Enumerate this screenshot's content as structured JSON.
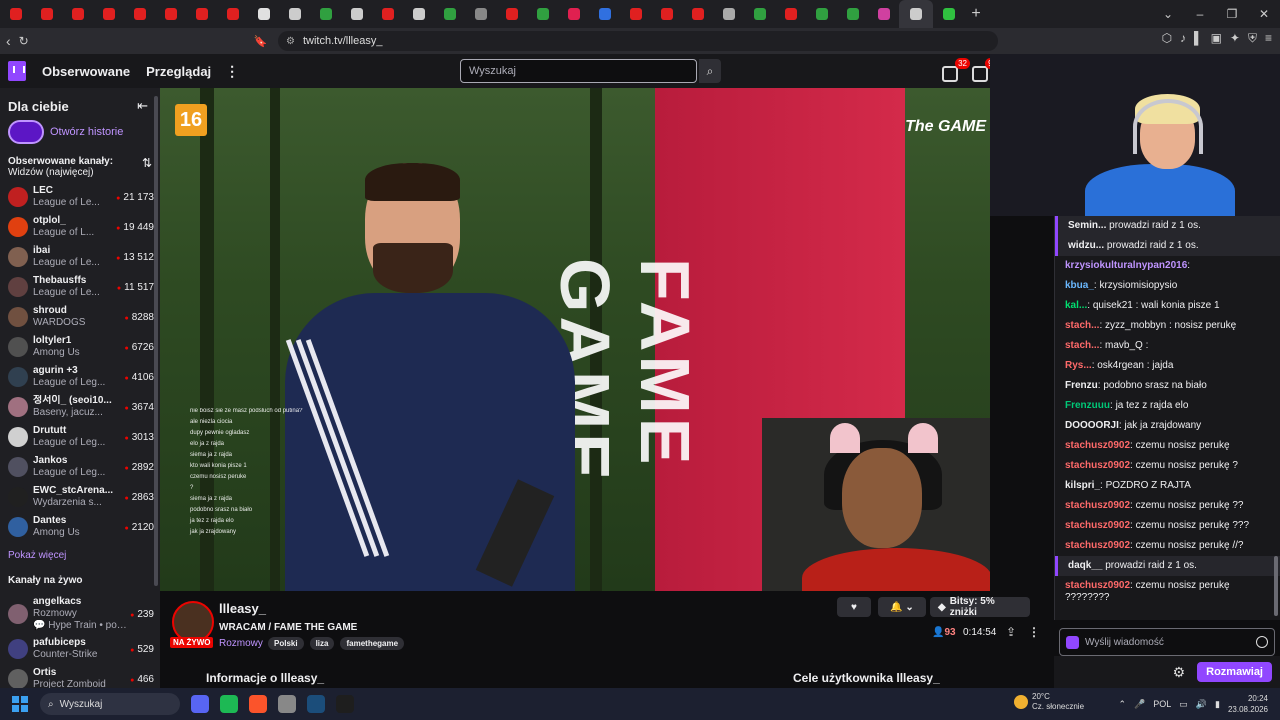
{
  "browser": {
    "url": "twitch.tv/llleasy_",
    "tabs": [
      {
        "color": "#e02020"
      },
      {
        "color": "#e02020"
      },
      {
        "color": "#e02020"
      },
      {
        "color": "#e02020"
      },
      {
        "color": "#e02020"
      },
      {
        "color": "#e02020"
      },
      {
        "color": "#e02020"
      },
      {
        "color": "#e02020"
      },
      {
        "color": "#e0e0e0"
      },
      {
        "color": "#cccccc"
      },
      {
        "color": "#30a040"
      },
      {
        "color": "#cccccc"
      },
      {
        "color": "#e02020"
      },
      {
        "color": "#cccccc"
      },
      {
        "color": "#30a040"
      },
      {
        "color": "#888888"
      },
      {
        "color": "#e02020"
      },
      {
        "color": "#30a040"
      },
      {
        "color": "#e02050"
      },
      {
        "color": "#3070e0"
      },
      {
        "color": "#e02020"
      },
      {
        "color": "#e02020"
      },
      {
        "color": "#e02020"
      },
      {
        "color": "#aaaaaa"
      },
      {
        "color": "#30a040"
      },
      {
        "color": "#e02020"
      },
      {
        "color": "#30a040"
      },
      {
        "color": "#30a040"
      },
      {
        "color": "#d040a0"
      },
      {
        "color": "#cccccc"
      },
      {
        "color": "#30c040"
      }
    ]
  },
  "nav": {
    "following": "Obserwowane",
    "browse": "Przeglądaj",
    "search_placeholder": "Wyszukaj",
    "badge1": "32",
    "badge2": "99"
  },
  "sidebar": {
    "title": "Dla ciebie",
    "stories": "Otwórz historie",
    "followed_title": "Obserwowane kanały:",
    "followed_sort": "Widzów (najwięcej)",
    "channels": [
      {
        "name": "LEC",
        "game": "League of Le...",
        "viewers": "21 173",
        "color": "#c02020"
      },
      {
        "name": "otplol_",
        "game": "League of L...",
        "viewers": "19 449",
        "color": "#e04010"
      },
      {
        "name": "ibai",
        "game": "League of Le...",
        "viewers": "13 512",
        "color": "#806050"
      },
      {
        "name": "Thebausffs",
        "game": "League of Le...",
        "viewers": "11 517",
        "color": "#604040"
      },
      {
        "name": "shroud",
        "game": "WARDOGS",
        "viewers": "8288",
        "color": "#705040"
      },
      {
        "name": "loltyler1",
        "game": "Among Us",
        "viewers": "6726",
        "color": "#505050"
      },
      {
        "name": "agurin +3",
        "game": "League of Leg...",
        "viewers": "4106",
        "color": "#304050"
      },
      {
        "name": "정서이_ (seoi10...",
        "game": "Baseny, jacuz...",
        "viewers": "3674",
        "color": "#a07080"
      },
      {
        "name": "Drututt",
        "game": "League of Leg...",
        "viewers": "3013",
        "color": "#d0d0d0"
      },
      {
        "name": "Jankos",
        "game": "League of Leg...",
        "viewers": "2892",
        "color": "#505060"
      },
      {
        "name": "EWC_stcArena...",
        "game": "Wydarzenia s...",
        "viewers": "2863",
        "color": "#202020"
      },
      {
        "name": "Dantes",
        "game": "Among Us",
        "viewers": "2120",
        "color": "#3060a0"
      }
    ],
    "show_more": "Pokaż więcej",
    "live_title": "Kanały na żywo",
    "live_channels": [
      {
        "name": "angelkacs",
        "game": "Rozmowy",
        "extra": "💬 Hype Train • pozio...",
        "viewers": "239",
        "color": "#806070"
      },
      {
        "name": "pafubiceps",
        "game": "Counter-Strike",
        "viewers": "529",
        "color": "#404080"
      },
      {
        "name": "Ortis",
        "game": "Project Zomboid",
        "viewers": "466",
        "color": "#606060"
      }
    ]
  },
  "video": {
    "age": "16",
    "banner": "FAME GAME",
    "logo": "The GAME",
    "overlay": [
      "nie boisz sie ze masz podsluch od putina?",
      "ale niezla ciocia",
      "dupy pewnie ogladasz",
      "elo ja z rajda",
      "siema ja z rajda",
      "kto wali konia pisze 1",
      "czemu nosisz peruke",
      "?",
      "siema ja z rajda",
      "podobno srasz na biało",
      "ja tez z rajda elo",
      "jak ja zrajdowany"
    ]
  },
  "stream": {
    "name": "llleasy_",
    "title": "WRACAM / FAME THE GAME",
    "category": "Rozmowy",
    "tags": [
      "Polski",
      "liza",
      "famethegame"
    ],
    "live": "NA ŻYWO",
    "bits": "Bitsy: 5% zniżki",
    "viewers": "93",
    "uptime": "0:14:54",
    "about": "Informacje o llleasy_",
    "goals": "Cele użytkownika llleasy_"
  },
  "chat": {
    "messages": [
      {
        "user": "Semin...",
        "text": "prowadzi raid z 1 os.",
        "color": "#efeff1",
        "sys": true
      },
      {
        "user": "widzu...",
        "text": "prowadzi raid z 1 os.",
        "color": "#efeff1",
        "sys": true
      },
      {
        "user": "krzysiokulturalnypan2016",
        "text": "",
        "color": "#bf94ff"
      },
      {
        "user": "kbua_",
        "text": "krzysiomisiopysio",
        "color": "#6ab8ff"
      },
      {
        "user": "kal...",
        "text": "quisek21 : wali konia pisze 1",
        "color": "#00e070"
      },
      {
        "user": "stach...",
        "text": "zyzz_mobbyn : nosisz perukę",
        "color": "#ff6a6a"
      },
      {
        "user": "stach...",
        "text": "mavb_Q :",
        "color": "#ff6a6a"
      },
      {
        "user": "Rys...",
        "text": "osk4rgean : jajda",
        "color": "#ff6a6a"
      },
      {
        "user": "Frenzu",
        "text": "podobno srasz na biało",
        "color": "#efeff1"
      },
      {
        "user": "Frenzuuu",
        "text": "ja tez z rajda elo",
        "color": "#00c878"
      },
      {
        "user": "DOOOORJI",
        "text": "jak ja zrajdowany",
        "color": "#efeff1"
      },
      {
        "user": "stachusz0902",
        "text": "czemu nosisz perukę",
        "color": "#ff6a6a"
      },
      {
        "user": "stachusz0902",
        "text": "czemu nosisz perukę ?",
        "color": "#ff6a6a"
      },
      {
        "user": "kilspri_",
        "text": "POZDRO Z RAJTA",
        "color": "#efeff1"
      },
      {
        "user": "stachusz0902",
        "text": "czemu nosisz perukę ??",
        "color": "#ff6a6a"
      },
      {
        "user": "stachusz0902",
        "text": "czemu nosisz perukę ???",
        "color": "#ff6a6a"
      },
      {
        "user": "stachusz0902",
        "text": "czemu nosisz perukę //?",
        "color": "#ff6a6a"
      },
      {
        "user": "daqk__",
        "text": "prowadzi raid z 1 os.",
        "color": "#efeff1",
        "sys": true
      },
      {
        "user": "stachusz0902",
        "text": "czemu nosisz perukę ????????",
        "color": "#ff6a6a"
      }
    ],
    "input_placeholder": "Wyślij wiadomość",
    "send": "Rozmawiaj"
  },
  "taskbar": {
    "search": "Wyszukaj",
    "weather_temp": "20°C",
    "weather_desc": "Cz. słonecznie",
    "lang": "POL",
    "time": "20:24",
    "date": "23.08.2026",
    "apps": [
      {
        "color": "#5865f2"
      },
      {
        "color": "#1db954"
      },
      {
        "color": "#fb542b"
      },
      {
        "color": "#888888"
      },
      {
        "color": "#1b4d7a"
      },
      {
        "color": "#1e1e1e"
      }
    ]
  }
}
